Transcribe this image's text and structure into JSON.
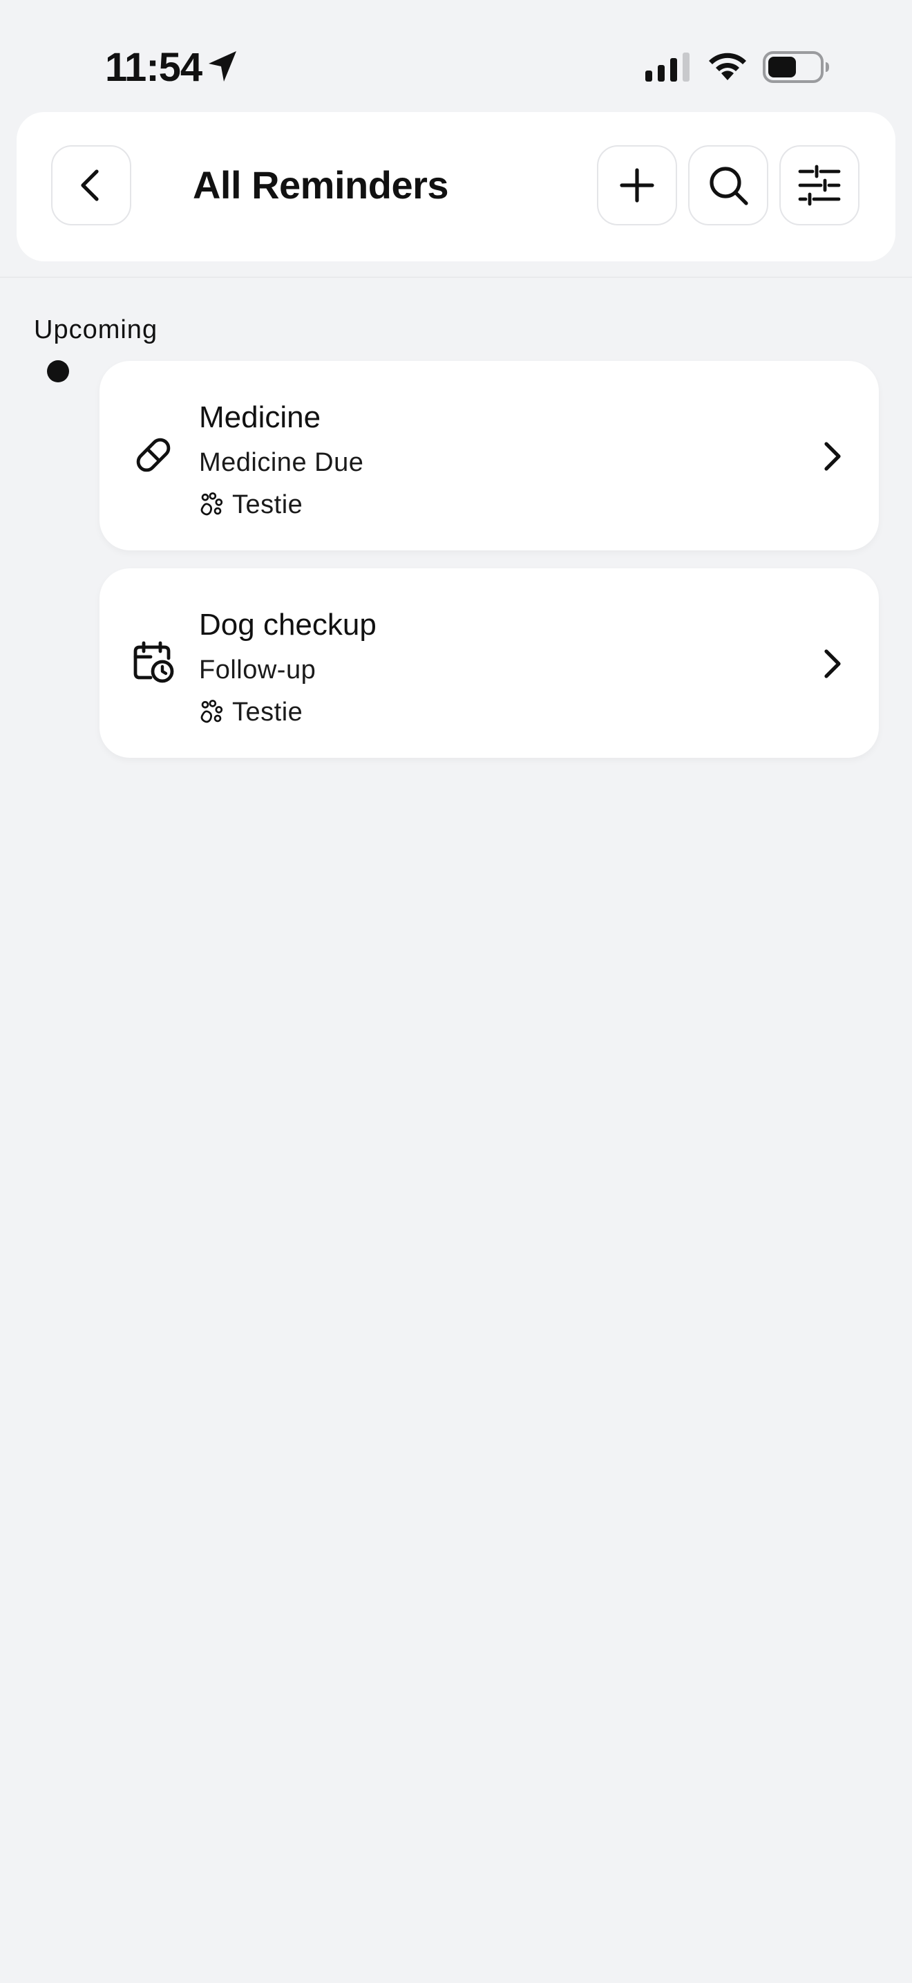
{
  "status_bar": {
    "time": "11:54",
    "icons": [
      "location-arrow-icon",
      "signal-icon",
      "wifi-icon",
      "battery-icon"
    ]
  },
  "header": {
    "title": "All Reminders",
    "buttons": {
      "back": "chevron-left-icon",
      "add": "plus-icon",
      "search": "search-icon",
      "filter": "sliders-icon"
    }
  },
  "section": {
    "label": "Upcoming"
  },
  "reminders": [
    {
      "title": "Medicine",
      "subtitle": "Medicine Due",
      "pet": "Testie",
      "icon": "pill-icon"
    },
    {
      "title": "Dog checkup",
      "subtitle": "Follow-up",
      "pet": "Testie",
      "icon": "calendar-clock-icon"
    }
  ],
  "colors": {
    "background": "#f2f3f5",
    "card": "#ffffff",
    "text": "#111111",
    "border": "#e4e5e8"
  }
}
